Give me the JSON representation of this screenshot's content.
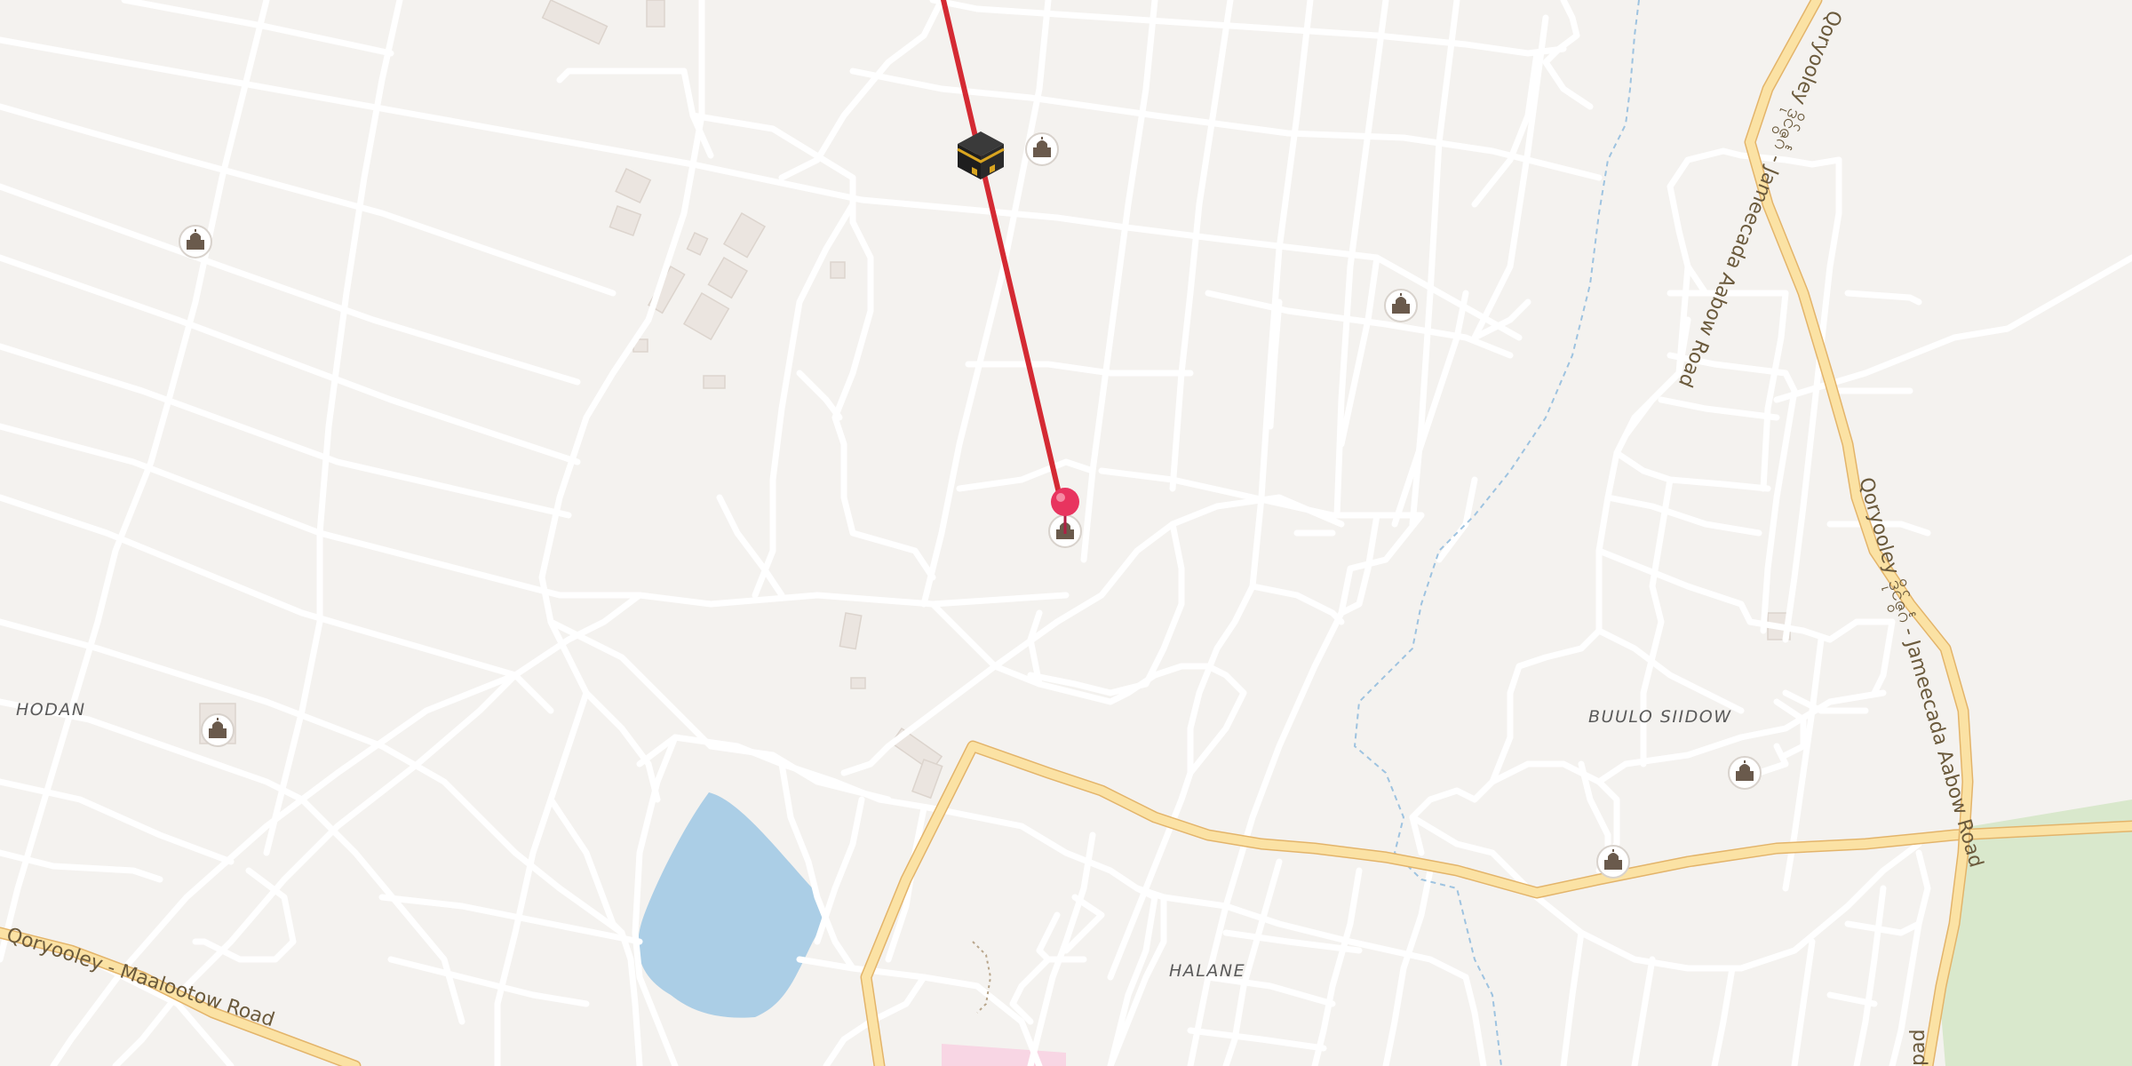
{
  "map": {
    "area_labels": [
      {
        "id": "hodan",
        "text": "HODAN"
      },
      {
        "id": "buulo-siidow",
        "text": "BUULO SIIDOW"
      },
      {
        "id": "halane",
        "text": "HALANE"
      }
    ],
    "road_labels": [
      {
        "id": "maalootow",
        "text": "Qoryooley - Maalootow Road"
      },
      {
        "id": "aabow-north",
        "text": "Qoryooley ဒိုင်ဇွင်္ဂ - Jameecada Aabow Road"
      },
      {
        "id": "aabow-south",
        "text": "Qoryooley ဒိုင်ဇွင်္ဂ - Jameecada Aabow Road"
      },
      {
        "id": "aabow-edge",
        "text": "pad"
      }
    ],
    "markers": {
      "kaaba_icon": "kaaba-icon",
      "location_pin": "location-pin-icon",
      "mosque_icon": "mosque-icon",
      "pin_color": "#e8345f",
      "route_color": "#d42a33"
    },
    "colors": {
      "background": "#f4f2ef",
      "water": "#abcee6",
      "park": "#d9e8cc",
      "main_road": "#fbe2a4",
      "main_road_casing": "#e3b46a",
      "minor_road": "#ffffff"
    }
  }
}
